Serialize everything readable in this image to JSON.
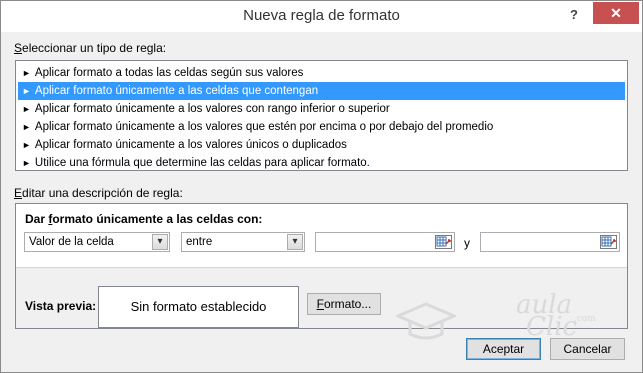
{
  "window": {
    "title": "Nueva regla de formato",
    "help_glyph": "?",
    "close_glyph": "✕"
  },
  "rule_type": {
    "label_underlined": "S",
    "label_rest": "eleccionar un tipo de regla:",
    "items": [
      "Aplicar formato a todas las celdas según sus valores",
      "Aplicar formato únicamente a las celdas que contengan",
      "Aplicar formato únicamente a los valores con rango inferior o superior",
      "Aplicar formato únicamente a los valores que estén por encima o por debajo del promedio",
      "Aplicar formato únicamente a los valores únicos o duplicados",
      "Utilice una fórmula que determine las celdas para aplicar formato."
    ],
    "selected_index": 1,
    "item_marker": "►"
  },
  "description": {
    "label_underlined": "E",
    "label_rest": "ditar una descripción de regla:",
    "heading_a": "Dar ",
    "heading_underlined": "f",
    "heading_b": "ormato únicamente a las celdas con:",
    "condition_select": "Valor de la celda",
    "operator_select": "entre",
    "value1": "",
    "value2": "",
    "joiner": "y",
    "preview_label": "Vista previa:",
    "preview_text": "Sin formato establecido",
    "format_button_underlined": "F",
    "format_button_rest": "ormato..."
  },
  "footer": {
    "accept_label": "Aceptar",
    "cancel_label": "Cancelar"
  },
  "watermark": {
    "line1": "aula",
    "line2": "Clic",
    "domain": ".com"
  },
  "colors": {
    "selection": "#3399ff",
    "close_button": "#c75050",
    "dialog_bg": "#f0f0f0"
  }
}
